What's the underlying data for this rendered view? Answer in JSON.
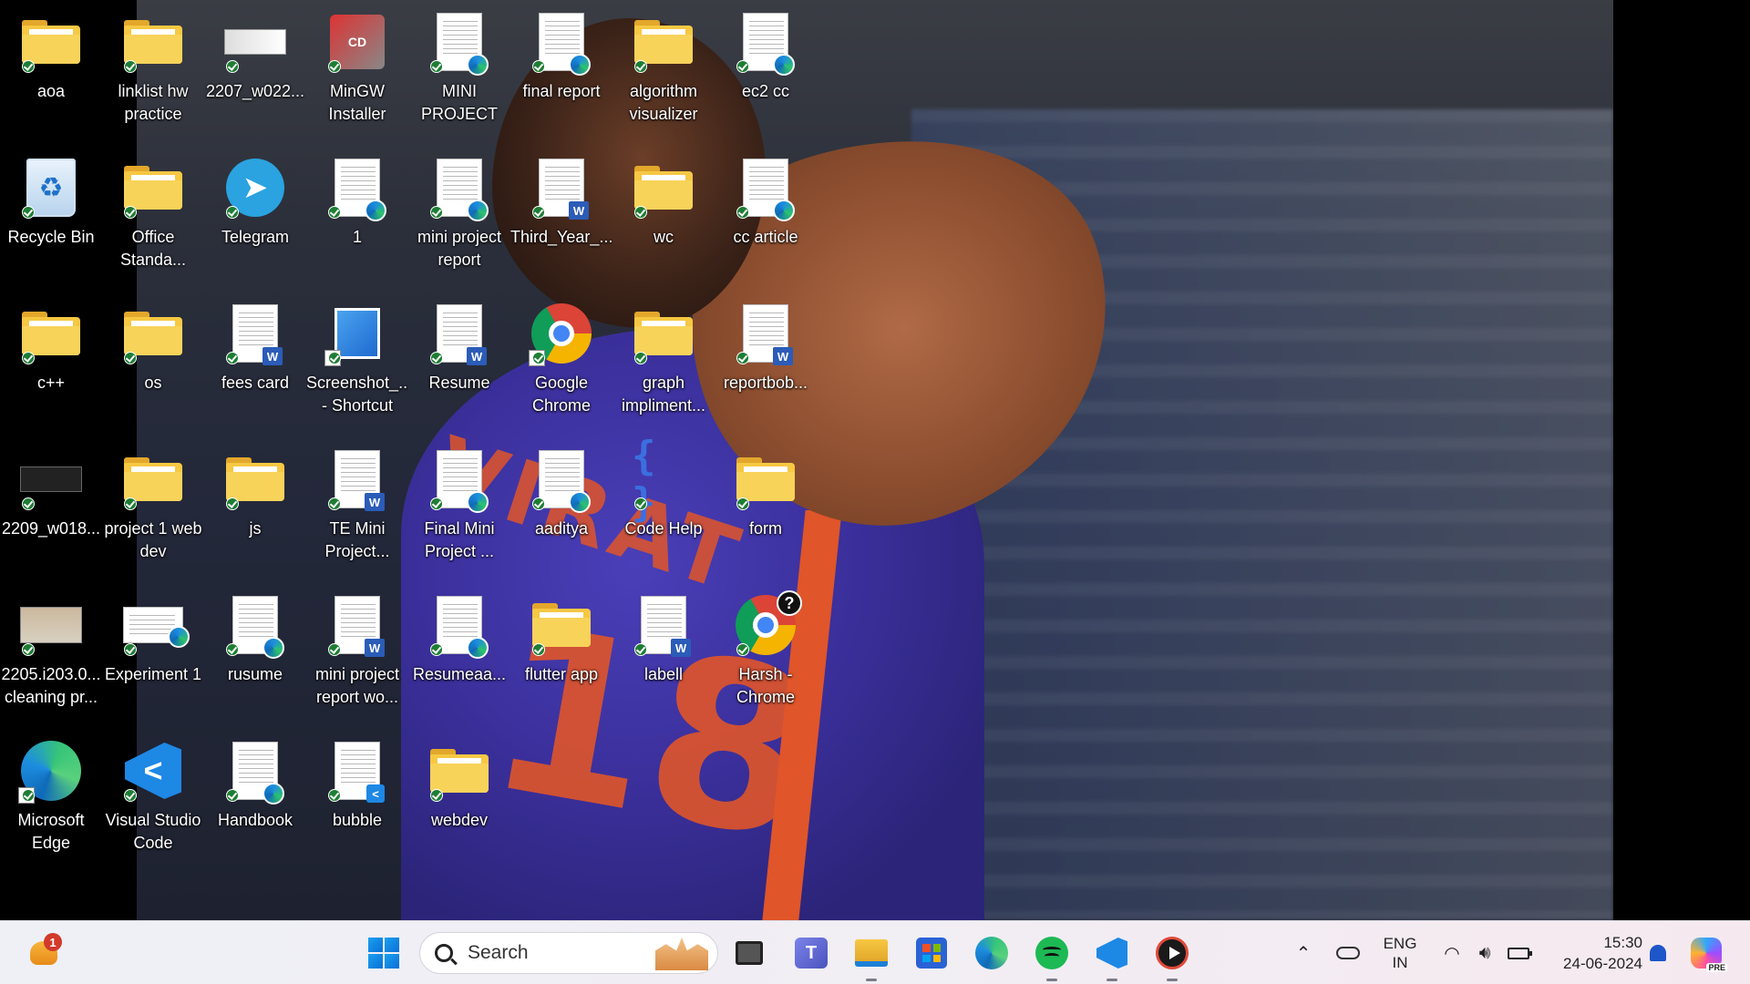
{
  "desktop": {
    "icons": [
      {
        "label": "aoa",
        "type": "folder"
      },
      {
        "label": "linklist hw practice",
        "type": "folder"
      },
      {
        "label": "2207_w022...",
        "type": "image"
      },
      {
        "label": "MinGW Installer",
        "type": "installer"
      },
      {
        "label": "MINI PROJECT",
        "type": "doc-edge"
      },
      {
        "label": "final report",
        "type": "doc-edge"
      },
      {
        "label": "algorithm visualizer",
        "type": "folder"
      },
      {
        "label": "ec2 cc",
        "type": "doc-edge"
      },
      {
        "label": "Recycle Bin",
        "type": "recycle"
      },
      {
        "label": "Office Standa...",
        "type": "folder"
      },
      {
        "label": "Telegram",
        "type": "telegram"
      },
      {
        "label": "1",
        "type": "doc-edge"
      },
      {
        "label": "mini project report",
        "type": "doc-edge"
      },
      {
        "label": "Third_Year_...",
        "type": "doc-word"
      },
      {
        "label": "wc",
        "type": "folder"
      },
      {
        "label": "cc article",
        "type": "doc-edge"
      },
      {
        "label": "c++",
        "type": "folder"
      },
      {
        "label": "os",
        "type": "folder"
      },
      {
        "label": "fees card",
        "type": "doc-word"
      },
      {
        "label": "Screenshot_... - Shortcut",
        "type": "image-shortcut"
      },
      {
        "label": "Resume",
        "type": "doc-word"
      },
      {
        "label": "Google Chrome",
        "type": "chrome"
      },
      {
        "label": "graph impliment...",
        "type": "folder"
      },
      {
        "label": "reportbob...",
        "type": "doc-word"
      },
      {
        "label": "2209_w018...",
        "type": "image-dark"
      },
      {
        "label": "project 1 web dev",
        "type": "folder"
      },
      {
        "label": "js",
        "type": "folder"
      },
      {
        "label": "TE Mini Project...",
        "type": "doc-word"
      },
      {
        "label": "Final Mini Project ...",
        "type": "doc-edge"
      },
      {
        "label": "aaditya",
        "type": "doc-edge"
      },
      {
        "label": "Code Help",
        "type": "codehelp"
      },
      {
        "label": "form",
        "type": "folder"
      },
      {
        "label": "2205.i203.0... cleaning pr...",
        "type": "image-room"
      },
      {
        "label": "Experiment 1",
        "type": "doc-edge-wide"
      },
      {
        "label": "rusume",
        "type": "doc-edge"
      },
      {
        "label": "mini project report wo...",
        "type": "doc-word"
      },
      {
        "label": "Resumeaa...",
        "type": "doc-edge"
      },
      {
        "label": "flutter app",
        "type": "folder"
      },
      {
        "label": "labell",
        "type": "doc-word"
      },
      {
        "label": "Harsh - Chrome",
        "type": "chrome-profile"
      },
      {
        "label": "Microsoft Edge",
        "type": "edge"
      },
      {
        "label": "Visual Studio Code",
        "type": "vscode"
      },
      {
        "label": "Handbook",
        "type": "doc-edge"
      },
      {
        "label": "bubble",
        "type": "doc-vscode"
      },
      {
        "label": "webdev",
        "type": "folder"
      }
    ]
  },
  "wallpaper": {
    "jersey_name": "VIRAT",
    "jersey_number": "18"
  },
  "taskbar": {
    "weather_badge": "1",
    "search_placeholder": "Search",
    "apps": [
      "start-icon",
      "task-view-icon",
      "teams-icon",
      "file-explorer-icon",
      "microsoft-store-icon",
      "edge-icon",
      "spotify-icon",
      "vscode-icon",
      "media-player-icon"
    ],
    "tray": {
      "language_line1": "ENG",
      "language_line2": "IN",
      "time": "15:30",
      "date": "24-06-2024",
      "copilot_badge": "PRE"
    }
  },
  "colors": {
    "accent": "#0a6fd6",
    "folder": "#f6c843",
    "sync_check": "#1e7d34"
  }
}
